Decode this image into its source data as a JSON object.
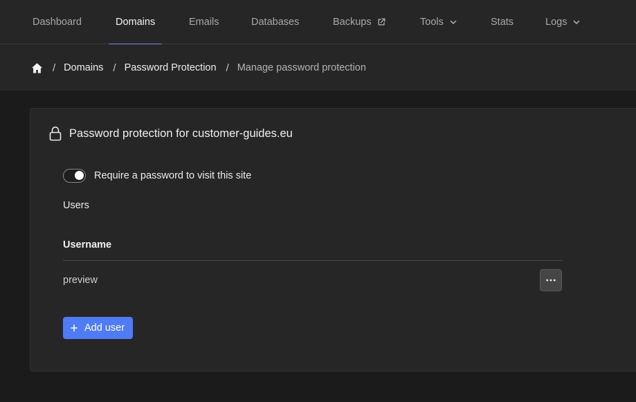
{
  "nav": {
    "items": [
      {
        "label": "Dashboard"
      },
      {
        "label": "Domains",
        "active": true
      },
      {
        "label": "Emails"
      },
      {
        "label": "Databases"
      },
      {
        "label": "Backups",
        "icon": "external-link-icon"
      },
      {
        "label": "Tools",
        "icon": "chevron-down-icon"
      },
      {
        "label": "Stats"
      },
      {
        "label": "Logs",
        "icon": "chevron-down-icon"
      }
    ]
  },
  "breadcrumb": {
    "home_icon": "home-icon",
    "separator": "/",
    "items": [
      "Domains",
      "Password Protection"
    ],
    "current": "Manage password protection"
  },
  "card": {
    "icon": "lock-icon",
    "title": "Password protection for customer-guides.eu",
    "toggle": {
      "label": "Require a password to visit this site",
      "enabled": true
    },
    "users_label": "Users",
    "table": {
      "columns": [
        "Username"
      ],
      "rows": [
        {
          "username": "preview"
        }
      ]
    },
    "add_button": {
      "label": "Add user",
      "icon": "plus-icon"
    }
  },
  "colors": {
    "accent": "#7c83f5",
    "primary_button": "#4f7cf5",
    "background": "#1b1b1b",
    "surface": "#262626"
  }
}
